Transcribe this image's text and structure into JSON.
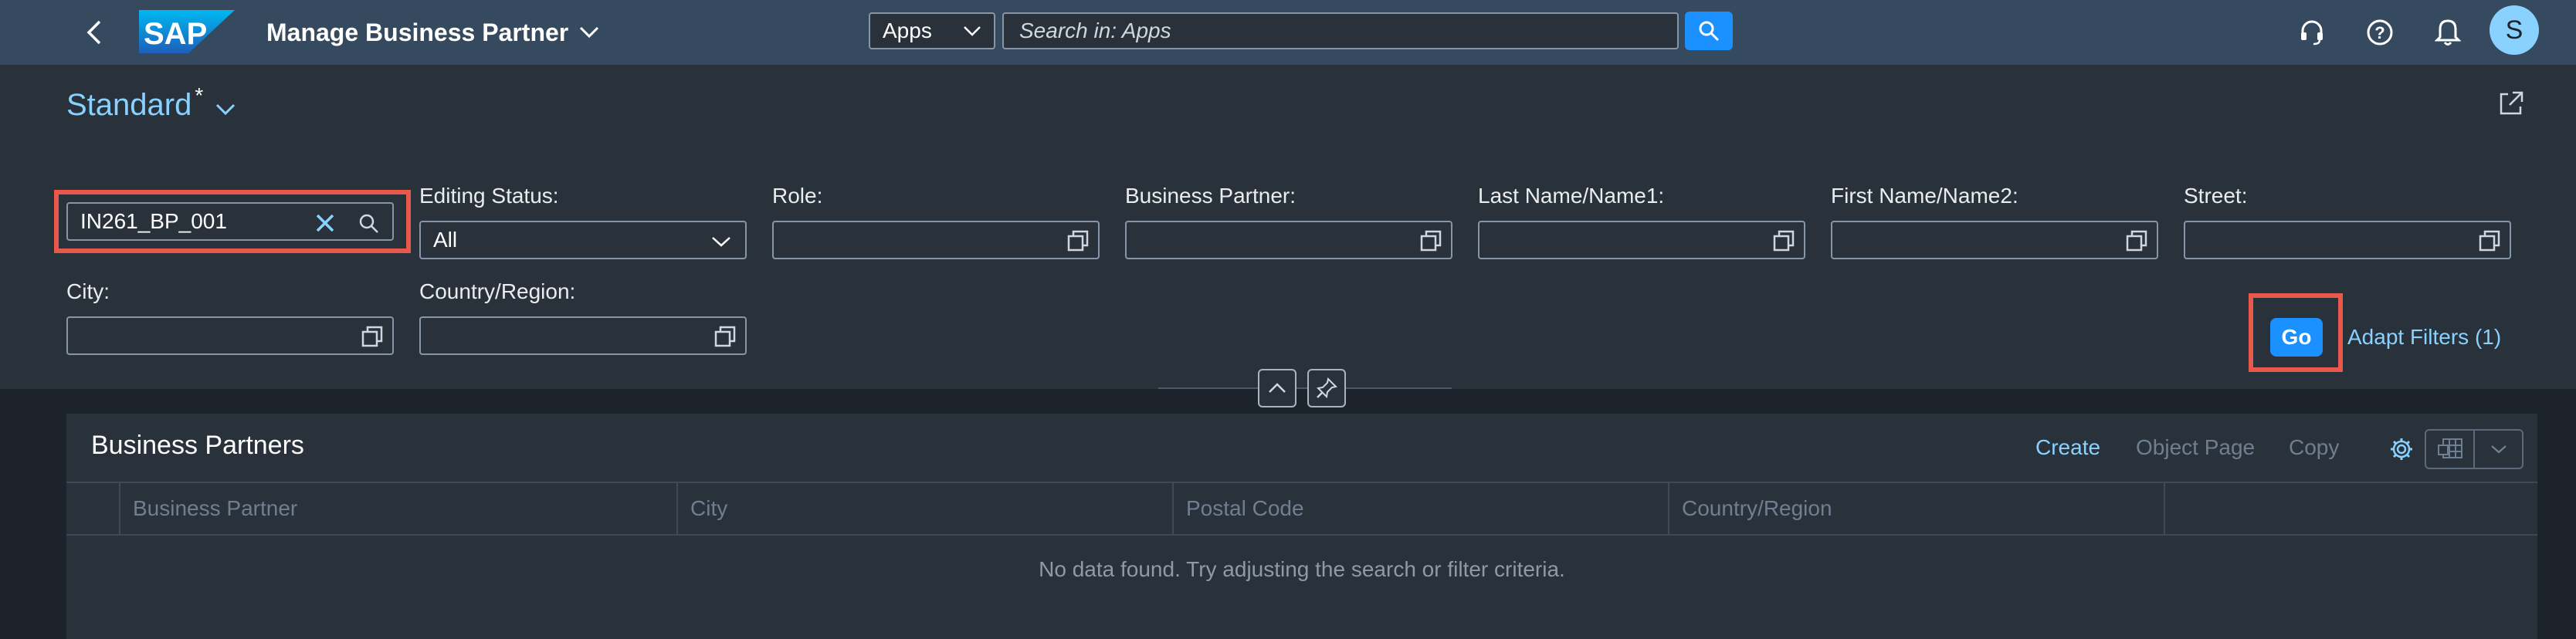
{
  "shell": {
    "app_title": "Manage Business Partner",
    "logo_text": "SAP",
    "search_scope": "Apps",
    "search_placeholder": "Search in: Apps",
    "avatar_initial": "S"
  },
  "header": {
    "variant_name": "Standard",
    "variant_modified": "*"
  },
  "filters": {
    "search_value": "IN261_BP_001",
    "editing_status_label": "Editing Status:",
    "editing_status_value": "All",
    "role_label": "Role:",
    "business_partner_label": "Business Partner:",
    "last_name_label": "Last Name/Name1:",
    "first_name_label": "First Name/Name2:",
    "street_label": "Street:",
    "city_label": "City:",
    "country_label": "Country/Region:",
    "go_label": "Go",
    "adapt_label": "Adapt Filters (1)"
  },
  "table": {
    "title": "Business Partners",
    "create_label": "Create",
    "object_page_label": "Object Page",
    "copy_label": "Copy",
    "columns": [
      "Business Partner",
      "City",
      "Postal Code",
      "Country/Region"
    ],
    "no_data": "No data found. Try adjusting the search or filter criteria."
  },
  "colors": {
    "shell_bg": "#354a5f",
    "header_bg": "#29313a",
    "accent": "#1b90ff",
    "link": "#89d1ff",
    "highlight": "#e8584b"
  }
}
